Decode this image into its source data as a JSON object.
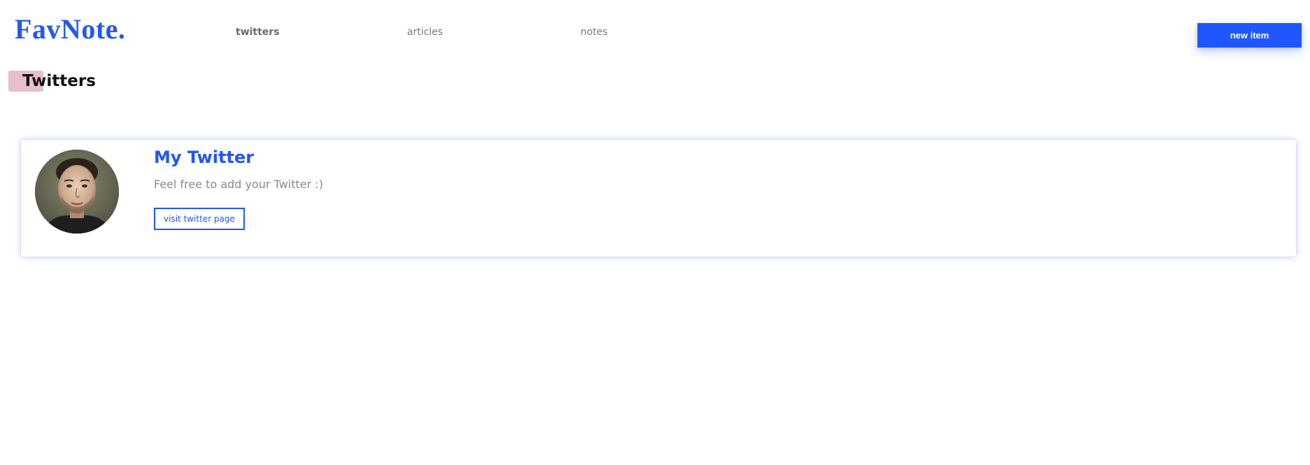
{
  "header": {
    "logo": "FavNote.",
    "nav": [
      {
        "label": "twitters",
        "active": true
      },
      {
        "label": "articles",
        "active": false
      },
      {
        "label": "notes",
        "active": false
      }
    ],
    "new_item_label": "new item"
  },
  "page": {
    "title": "Twitters"
  },
  "cards": [
    {
      "title": "My Twitter",
      "description": "Feel free to add your Twitter :)",
      "button_label": "visit twitter page",
      "avatar_icon": "user-avatar"
    }
  ],
  "colors": {
    "accent": "#1f56ff",
    "logo": "#2458f0",
    "title_highlight": "#e7bfcf",
    "muted_text": "#8a8a8a"
  }
}
